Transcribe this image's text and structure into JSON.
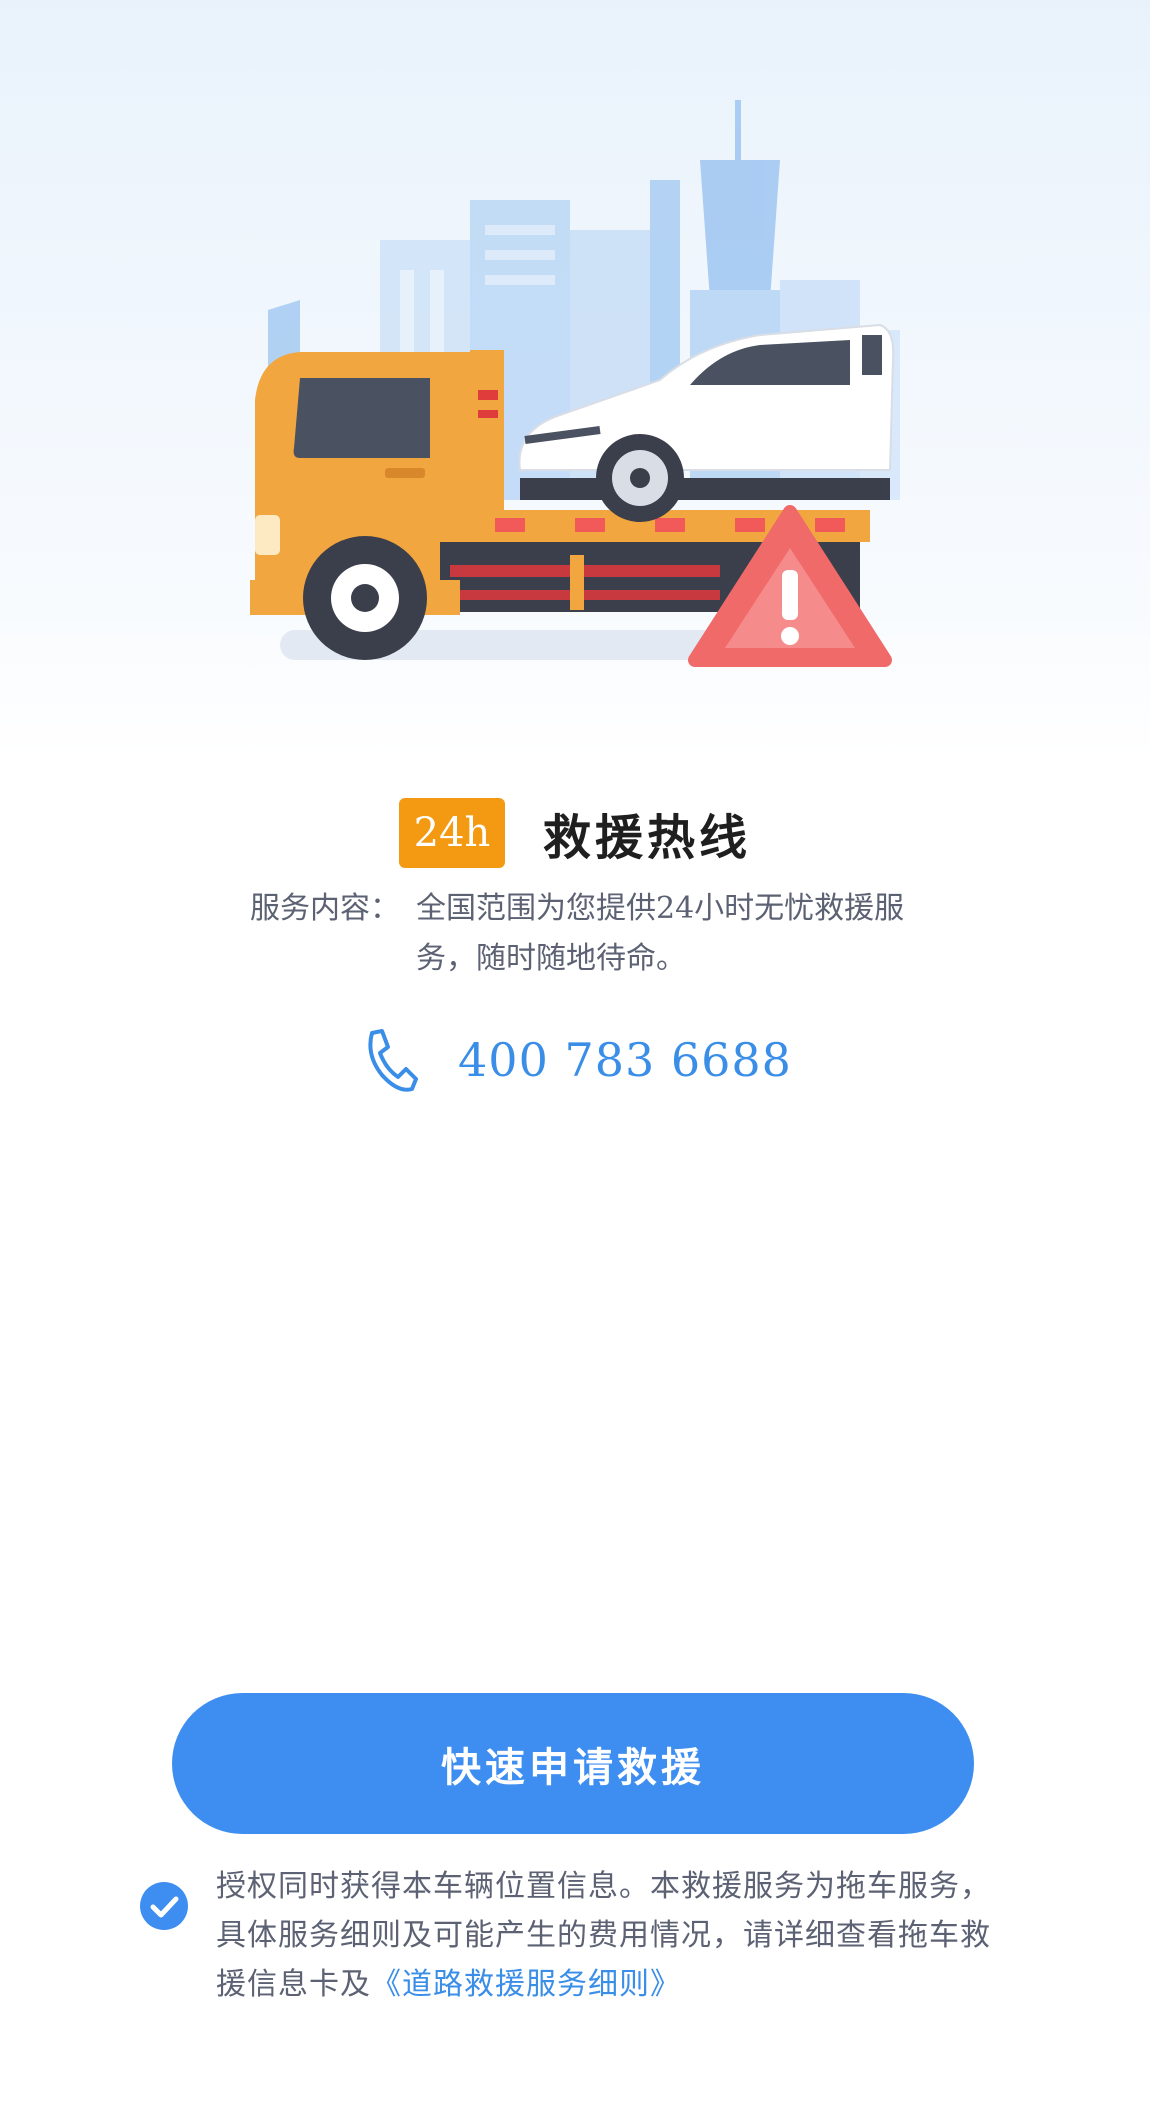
{
  "badge": {
    "label": "24h",
    "color": "#f39a12"
  },
  "title": "救援热线",
  "service": {
    "label": "服务内容：",
    "text": "全国范围为您提供24小时无忧救援服务，随时随地待命。"
  },
  "phone": {
    "icon": "phone-icon",
    "number": "400 783 6688"
  },
  "apply_button": {
    "label": "快速申请救援",
    "color": "#3d8ef0"
  },
  "agreement": {
    "checked": true,
    "icon": "check-circle-icon",
    "text": "授权同时获得本车辆位置信息。本救援服务为拖车服务，具体服务细则及可能产生的费用情况，请详细查看拖车救援信息卡及",
    "link": "《道路救援服务细则》"
  },
  "colors": {
    "accent": "#3a8ee8",
    "text_muted": "#5c6273",
    "alert": "#f06a6a"
  }
}
